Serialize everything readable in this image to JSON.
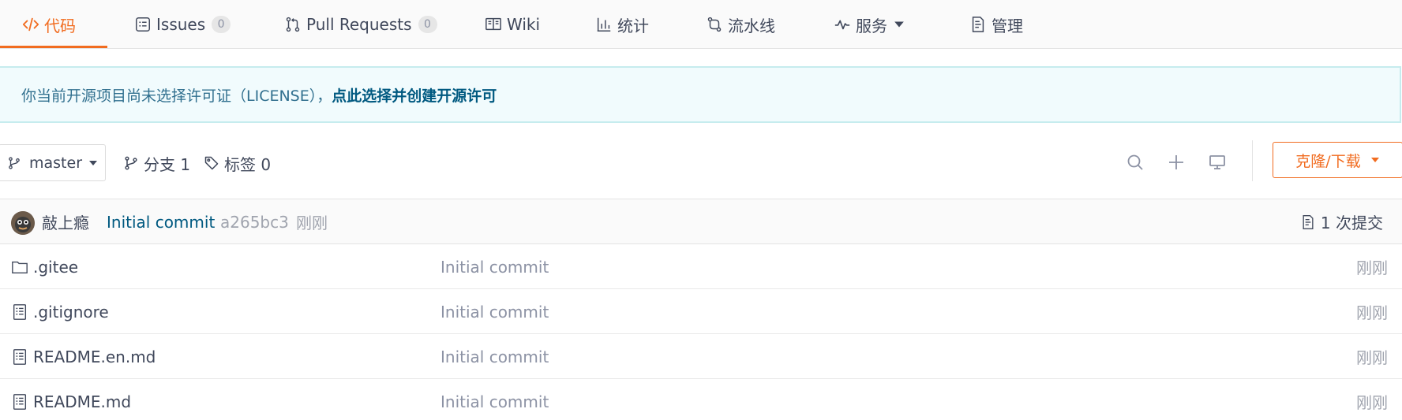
{
  "tabs": [
    {
      "label": "代码",
      "icon": "code-icon",
      "active": true
    },
    {
      "label": "Issues",
      "icon": "issues-icon",
      "count": "0"
    },
    {
      "label": "Pull Requests",
      "icon": "pull-request-icon",
      "count": "0"
    },
    {
      "label": "Wiki",
      "icon": "book-icon"
    },
    {
      "label": "统计",
      "icon": "bar-chart-icon"
    },
    {
      "label": "流水线",
      "icon": "pipeline-icon"
    },
    {
      "label": "服务",
      "icon": "pulse-icon",
      "has_dropdown": true
    },
    {
      "label": "管理",
      "icon": "document-icon"
    }
  ],
  "banner": {
    "text": "你当前开源项目尚未选择许可证（LICENSE），",
    "link": "点此选择并创建开源许可"
  },
  "branch": {
    "current": "master",
    "branches_label": "分支 1",
    "tags_label": "标签 0"
  },
  "toolbar": {
    "search_icon": "search-icon",
    "add_icon": "plus-icon",
    "web_ide_icon": "monitor-icon",
    "clone_label": "克隆/下载"
  },
  "last_commit": {
    "author": "敲上瘾",
    "message": "Initial commit",
    "sha": "a265bc3",
    "time": "刚刚",
    "commits_label": "1 次提交"
  },
  "files": [
    {
      "name": ".gitee",
      "type": "folder",
      "message": "Initial commit",
      "time": "刚刚"
    },
    {
      "name": ".gitignore",
      "type": "file",
      "message": "Initial commit",
      "time": "刚刚"
    },
    {
      "name": "README.en.md",
      "type": "file",
      "message": "Initial commit",
      "time": "刚刚"
    },
    {
      "name": "README.md",
      "type": "file",
      "message": "Initial commit",
      "time": "刚刚"
    }
  ],
  "colors": {
    "accent": "#f16c20",
    "link": "#005980",
    "banner_bg": "#f1fbfd"
  }
}
